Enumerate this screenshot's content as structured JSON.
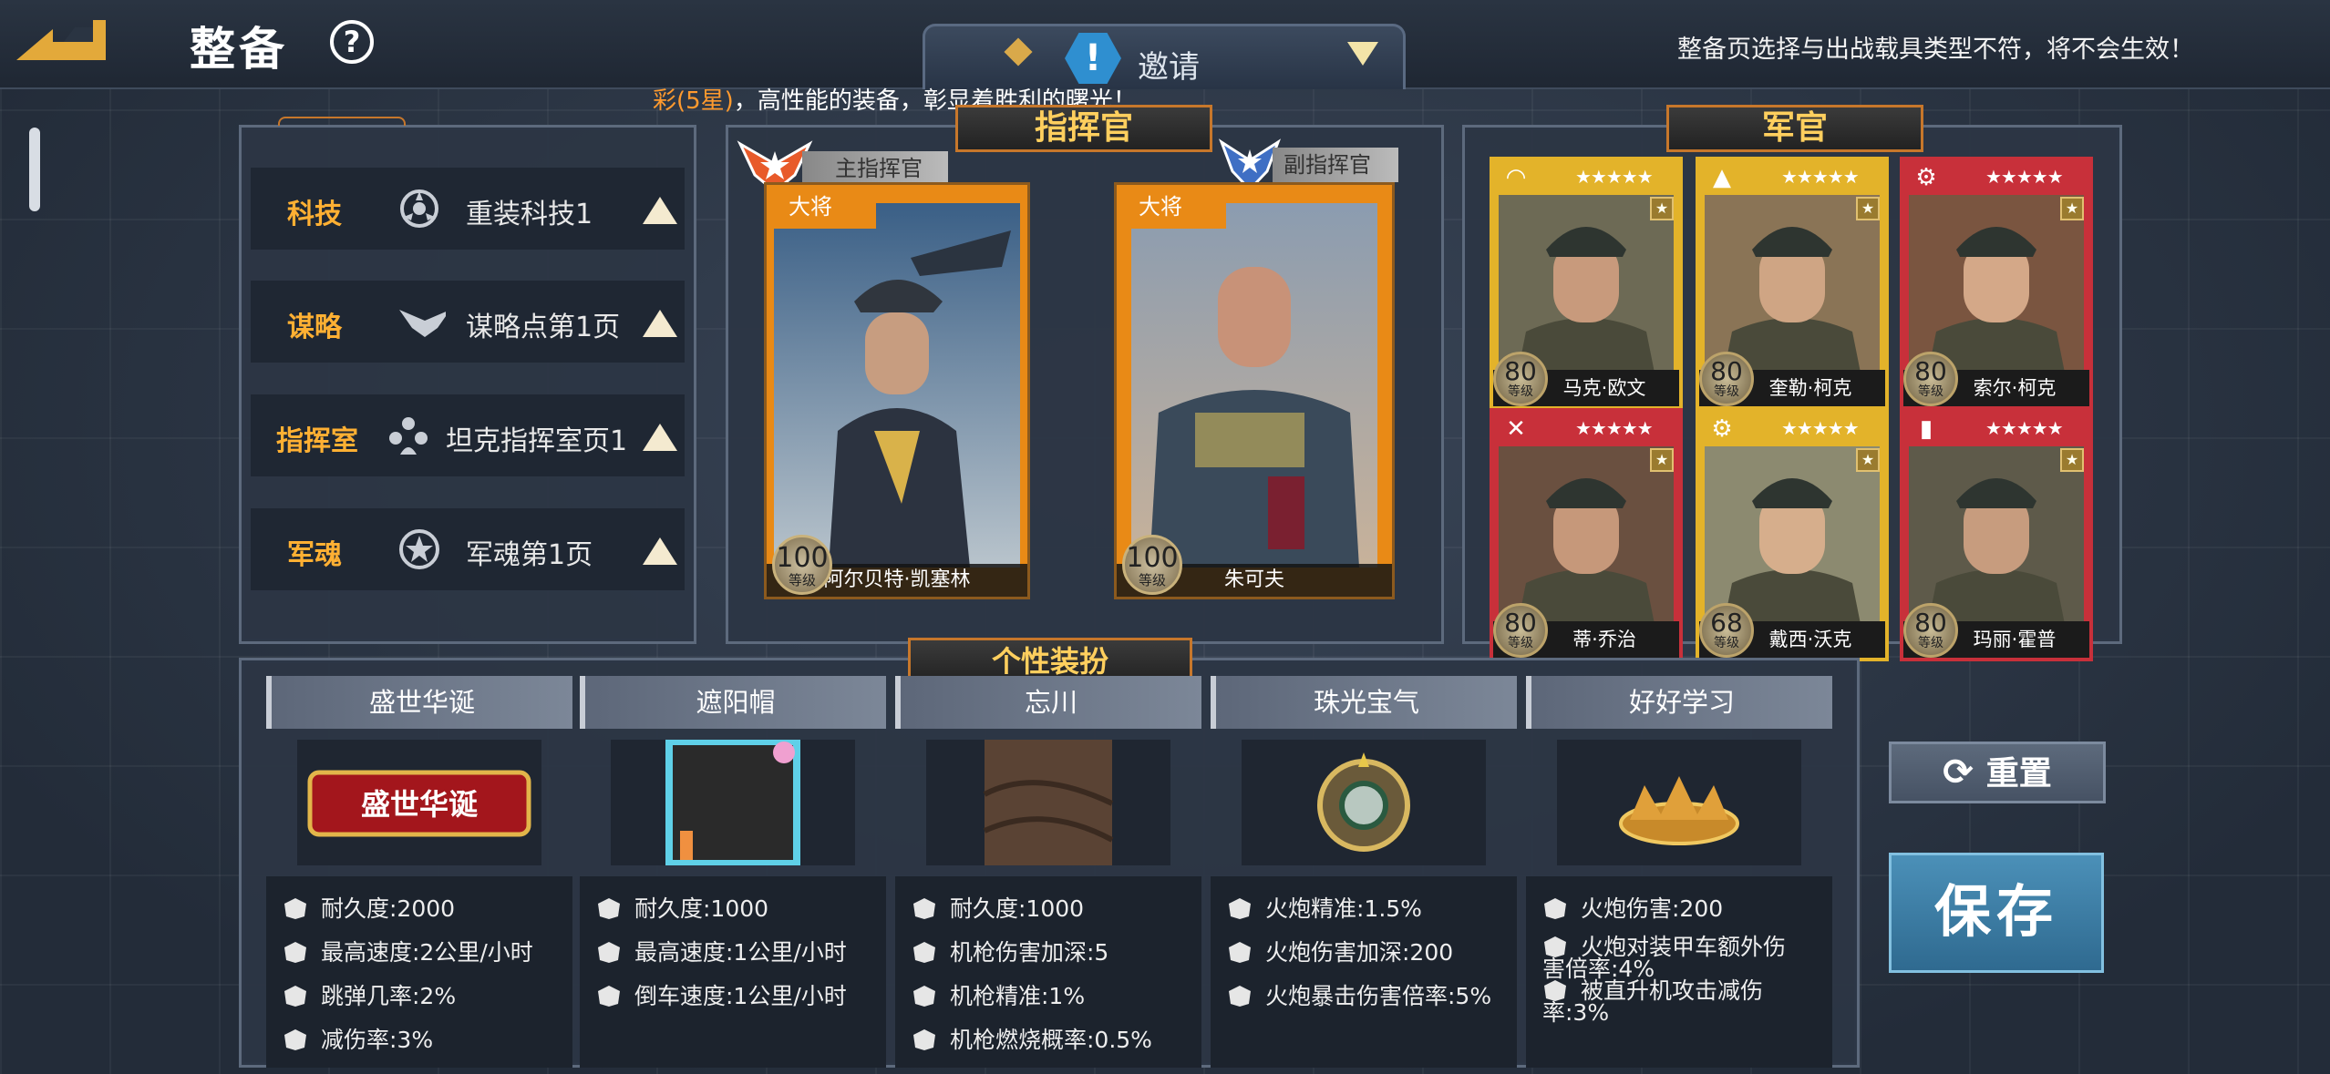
{
  "header": {
    "title": "整备",
    "help_glyph": "?",
    "notice": "整备页选择与出战载具类型不符，将不会生效！",
    "invite_label": "邀请",
    "invite_glyph": "!"
  },
  "ticker": {
    "highlight": "彩(5星)",
    "text": "，高性能的装备，彰显着胜利的曙光！"
  },
  "tech": [
    {
      "key": "科技",
      "value": "重装科技1",
      "icon": "tech-gear-icon"
    },
    {
      "key": "谋略",
      "value": "谋略点第1页",
      "icon": "eagle-icon"
    },
    {
      "key": "指挥室",
      "value": "坦克指挥室页1",
      "icon": "group-icon"
    },
    {
      "key": "军魂",
      "value": "军魂第1页",
      "icon": "star-medal-icon"
    }
  ],
  "commanders": {
    "header": "指挥官",
    "main": {
      "tag": "主指挥官",
      "rank": "大将",
      "level": "100",
      "level_label": "等级",
      "name": "阿尔贝特·凯塞林"
    },
    "vice": {
      "tag": "副指挥官",
      "rank": "大将",
      "level": "100",
      "level_label": "等级",
      "name": "朱可夫"
    }
  },
  "officers": {
    "header": "军官",
    "stars": "★★★★★",
    "level_label": "等级",
    "list": [
      {
        "name": "马克·欧文",
        "level": "80",
        "color": "#e3b32a",
        "type_icon": "beret-icon"
      },
      {
        "name": "奎勒·柯克",
        "level": "80",
        "color": "#e3b32a",
        "type_icon": "shell-icon"
      },
      {
        "name": "索尔·柯克",
        "level": "80",
        "color": "#c8303a",
        "type_icon": "gear-icon"
      },
      {
        "name": "蒂·乔治",
        "level": "80",
        "color": "#c8303a",
        "type_icon": "wrench-icon"
      },
      {
        "name": "戴西·沃克",
        "level": "68",
        "color": "#e3b32a",
        "type_icon": "cogs-icon"
      },
      {
        "name": "玛丽·霍普",
        "level": "80",
        "color": "#c8303a",
        "type_icon": "ammo-icon"
      }
    ]
  },
  "dress": {
    "header": "个性装扮",
    "items": [
      {
        "title": "盛世华诞",
        "banner": "盛世华诞",
        "stats": [
          "耐久度:2000",
          "最高速度:2公里/小时",
          "跳弹几率:2%",
          "减伤率:3%"
        ]
      },
      {
        "title": "遮阳帽",
        "stats": [
          "耐久度:1000",
          "最高速度:1公里/小时",
          "倒车速度:1公里/小时"
        ]
      },
      {
        "title": "忘川",
        "stats": [
          "耐久度:1000",
          "机枪伤害加深:5",
          "机枪精准:1%",
          "机枪燃烧概率:0.5%"
        ]
      },
      {
        "title": "珠光宝气",
        "stats": [
          "火炮精准:1.5%",
          "火炮伤害加深:200",
          "火炮暴击伤害倍率:5%"
        ]
      },
      {
        "title": "好好学习",
        "stats": [
          "火炮伤害:200",
          "火炮对装甲车额外伤害倍率:4%",
          "被直升机攻击减伤率:3%"
        ]
      }
    ]
  },
  "buttons": {
    "reset": "重置",
    "save": "保存"
  },
  "colors": {
    "accent": "#ffb033",
    "frame": "#c7772b",
    "save": "#2f6a90"
  }
}
